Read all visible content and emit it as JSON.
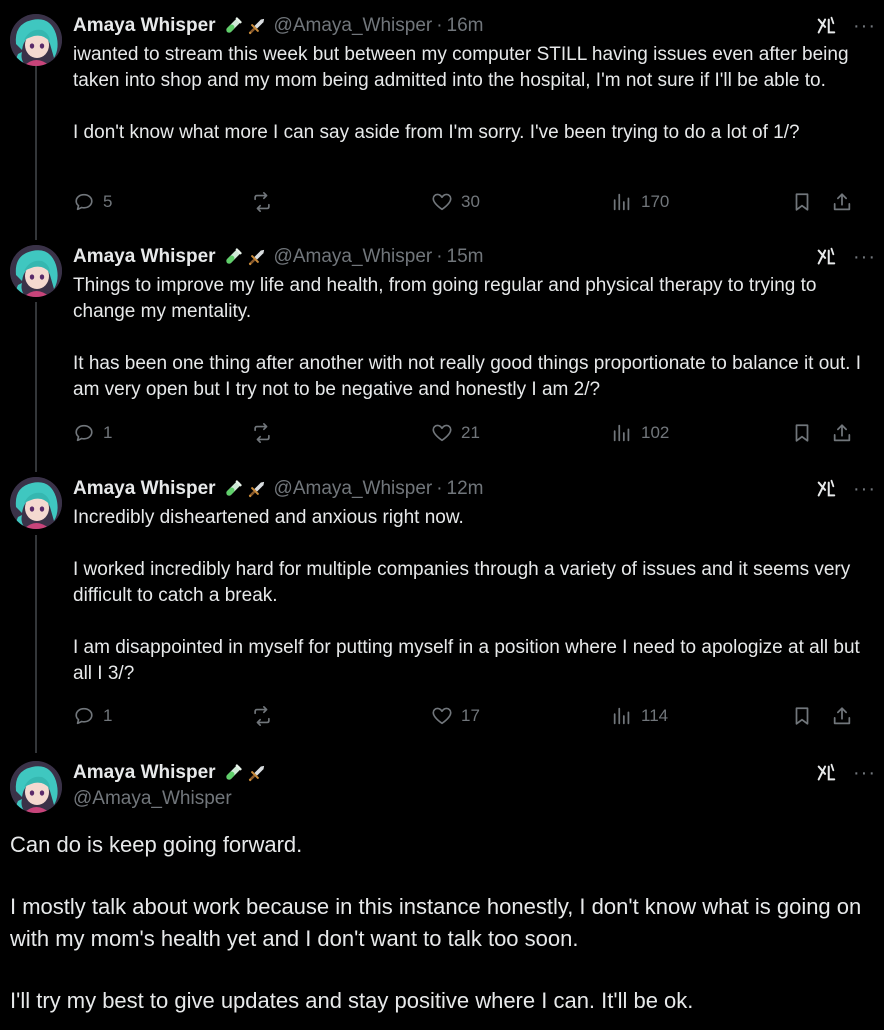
{
  "author": {
    "name": "Amaya Whisper",
    "handle": "@Amaya_Whisper",
    "badges": [
      "test-tube-icon",
      "dagger-icon"
    ]
  },
  "separator": "·",
  "tweets": [
    {
      "time": "16m",
      "paragraphs": [
        "iwanted to stream this week but between my computer STILL having issues even after being taken into shop and my mom being admitted into the hospital, I'm not sure if I'll be able to.",
        "I don't know what more I can say aside from I'm sorry. I've been trying to do a lot of 1/?"
      ],
      "replies": "5",
      "reposts": "",
      "likes": "30",
      "views": "170"
    },
    {
      "time": "15m",
      "paragraphs": [
        "Things to improve my life and health, from going regular and physical therapy to trying to change my mentality.",
        "It has been one thing after another with not really good things proportionate to balance it out. I am very open but I try not to be negative and honestly I am 2/?"
      ],
      "replies": "1",
      "reposts": "",
      "likes": "21",
      "views": "102"
    },
    {
      "time": "12m",
      "paragraphs": [
        "Incredibly disheartened and anxious right now.",
        "I worked incredibly hard for multiple companies through a variety of issues and it seems very difficult to catch a break.",
        "I am disappointed in myself for putting myself in a position where I need to apologize at all but all I 3/?"
      ],
      "replies": "1",
      "reposts": "",
      "likes": "17",
      "views": "114"
    }
  ],
  "final_tweet": {
    "paragraphs": [
      "Can do is keep going forward.",
      "I mostly talk about work because in this instance honestly, I don't know what is going on with my mom's health yet and I don't want to talk too soon.",
      "I'll try my best to give updates and stay positive where I can. It'll be ok."
    ]
  },
  "more_label": "···"
}
